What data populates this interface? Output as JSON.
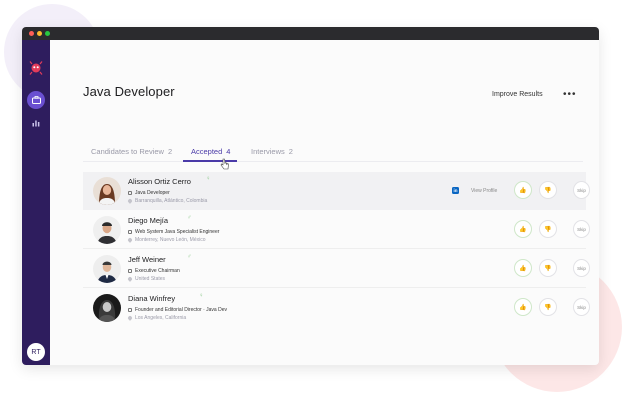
{
  "sidebar": {
    "nav": [
      {
        "icon": "briefcase-icon",
        "active": true
      },
      {
        "icon": "bar-chart-icon",
        "active": false
      }
    ],
    "user_initials": "RT"
  },
  "header": {
    "title": "Java Developer",
    "improve_label": "Improve Results",
    "more_label": "•••"
  },
  "tabs": [
    {
      "label": "Candidates to Review",
      "count": "2",
      "active": false
    },
    {
      "label": "Accepted",
      "count": "4",
      "active": true
    },
    {
      "label": "Interviews",
      "count": "2",
      "active": false
    }
  ],
  "candidates": [
    {
      "name": "Alisson Ortiz Cerro",
      "title": "Java Developer",
      "location": "Barranquilla, Atlántico, Colombia",
      "gender_icon": "female-symbol-icon",
      "linkedin": "in",
      "view_profile": "View Profile",
      "skip": "Skip"
    },
    {
      "name": "Diego Mejía",
      "title": "Web System Java Specialist Engineer",
      "location": "Monterrey, Nuevo León, México",
      "gender_icon": "male-symbol-icon",
      "skip": "Skip"
    },
    {
      "name": "Jeff Weiner",
      "title": "Executive Chairman",
      "location": "United States",
      "gender_icon": "male-symbol-icon",
      "skip": "Skip"
    },
    {
      "name": "Diana Winfrey",
      "title": "Founder and Editorial Director · Java Dev",
      "location": "Los Angeles, California",
      "gender_icon": "female-symbol-icon",
      "skip": "Skip"
    }
  ],
  "colors": {
    "sidebar": "#2e1d5e",
    "accent": "#4a3aa8",
    "approve": "#6db86a",
    "linkedin": "#0a66c2"
  }
}
